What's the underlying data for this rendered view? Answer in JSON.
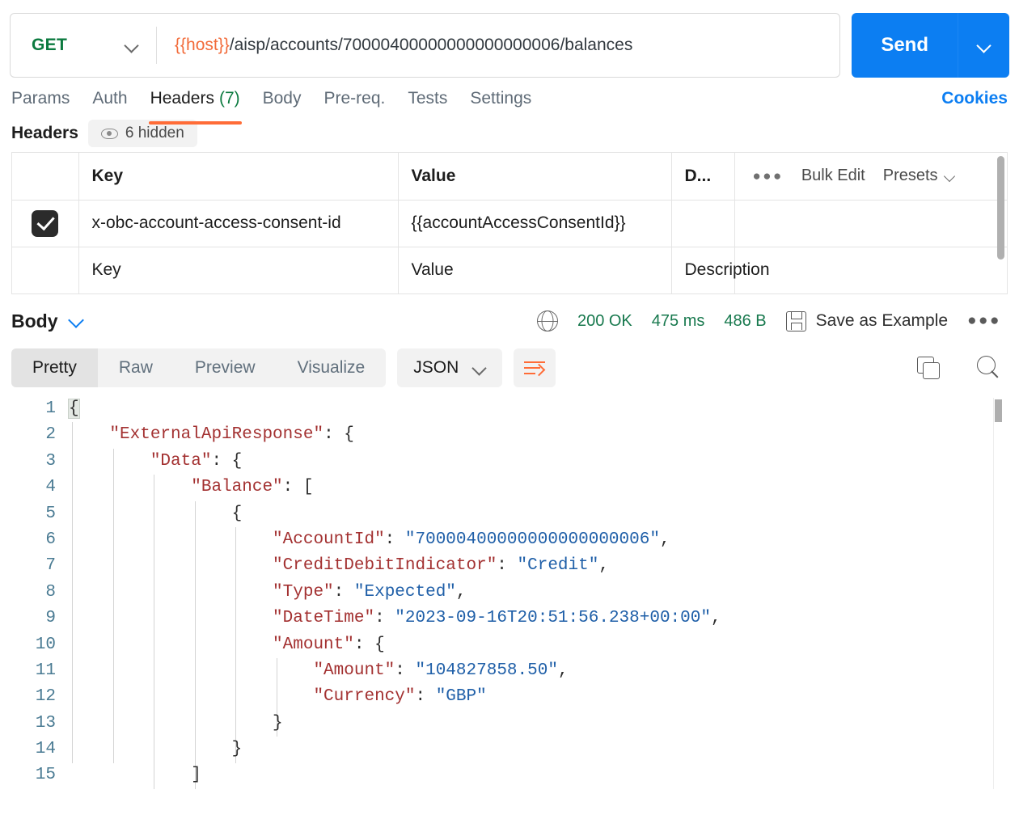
{
  "request": {
    "method": "GET",
    "method_caret_icon": "chevron-down-icon",
    "url_variable": "{{host}}",
    "url_path": "/aisp/accounts/70000400000000000000006/balances",
    "send_label": "Send",
    "send_caret_icon": "chevron-down-icon"
  },
  "request_tabs": [
    {
      "label": "Params",
      "count": "",
      "active": false
    },
    {
      "label": "Auth",
      "count": "",
      "active": false
    },
    {
      "label": "Headers",
      "count": "(7)",
      "active": true
    },
    {
      "label": "Body",
      "count": "",
      "active": false
    },
    {
      "label": "Pre-req.",
      "count": "",
      "active": false
    },
    {
      "label": "Tests",
      "count": "",
      "active": false
    },
    {
      "label": "Settings",
      "count": "",
      "active": false
    }
  ],
  "cookies_label": "Cookies",
  "headers_section": {
    "title": "Headers",
    "hidden_pill_label": "6 hidden",
    "eye_icon": "eye-icon",
    "columns": {
      "check": "",
      "key": "Key",
      "value": "Value",
      "description": "D..."
    },
    "toolbar": {
      "more_icon": "more-horizontal-icon",
      "bulk_edit": "Bulk Edit",
      "presets": "Presets",
      "presets_caret_icon": "chevron-down-icon"
    },
    "rows": [
      {
        "checked": true,
        "key": "x-obc-account-access-consent-id",
        "value": "{{accountAccessConsentId}}",
        "description": ""
      }
    ],
    "placeholder_row": {
      "key": "Key",
      "value": "Value",
      "description": "Description"
    }
  },
  "response": {
    "body_label": "Body",
    "body_caret_icon": "chevron-down-icon",
    "globe_icon": "globe-icon",
    "status": "200 OK",
    "time": "475 ms",
    "size": "486 B",
    "save_icon": "floppy-disk-icon",
    "save_as_example": "Save as Example",
    "more_icon": "more-horizontal-icon",
    "view_tabs": [
      {
        "label": "Pretty",
        "active": true
      },
      {
        "label": "Raw",
        "active": false
      },
      {
        "label": "Preview",
        "active": false
      },
      {
        "label": "Visualize",
        "active": false
      }
    ],
    "language": "JSON",
    "language_caret_icon": "chevron-down-icon",
    "wrap_icon": "word-wrap-icon",
    "copy_icon": "copy-icon",
    "search_icon": "search-icon",
    "code_lines": [
      {
        "n": "1",
        "indent": 0,
        "tokens": [
          {
            "t": "{",
            "c": "p",
            "hl": true
          }
        ]
      },
      {
        "n": "2",
        "indent": 1,
        "tokens": [
          {
            "t": "\"ExternalApiResponse\"",
            "c": "k"
          },
          {
            "t": ": {",
            "c": "p"
          }
        ]
      },
      {
        "n": "3",
        "indent": 2,
        "tokens": [
          {
            "t": "\"Data\"",
            "c": "k"
          },
          {
            "t": ": {",
            "c": "p"
          }
        ]
      },
      {
        "n": "4",
        "indent": 3,
        "tokens": [
          {
            "t": "\"Balance\"",
            "c": "k"
          },
          {
            "t": ": [",
            "c": "p"
          }
        ]
      },
      {
        "n": "5",
        "indent": 4,
        "tokens": [
          {
            "t": "{",
            "c": "p"
          }
        ]
      },
      {
        "n": "6",
        "indent": 5,
        "tokens": [
          {
            "t": "\"AccountId\"",
            "c": "k"
          },
          {
            "t": ": ",
            "c": "p"
          },
          {
            "t": "\"70000400000000000000006\"",
            "c": "s"
          },
          {
            "t": ",",
            "c": "p"
          }
        ]
      },
      {
        "n": "7",
        "indent": 5,
        "tokens": [
          {
            "t": "\"CreditDebitIndicator\"",
            "c": "k"
          },
          {
            "t": ": ",
            "c": "p"
          },
          {
            "t": "\"Credit\"",
            "c": "s"
          },
          {
            "t": ",",
            "c": "p"
          }
        ]
      },
      {
        "n": "8",
        "indent": 5,
        "tokens": [
          {
            "t": "\"Type\"",
            "c": "k"
          },
          {
            "t": ": ",
            "c": "p"
          },
          {
            "t": "\"Expected\"",
            "c": "s"
          },
          {
            "t": ",",
            "c": "p"
          }
        ]
      },
      {
        "n": "9",
        "indent": 5,
        "tokens": [
          {
            "t": "\"DateTime\"",
            "c": "k"
          },
          {
            "t": ": ",
            "c": "p"
          },
          {
            "t": "\"2023-09-16T20:51:56.238+00:00\"",
            "c": "s"
          },
          {
            "t": ",",
            "c": "p"
          }
        ]
      },
      {
        "n": "10",
        "indent": 5,
        "tokens": [
          {
            "t": "\"Amount\"",
            "c": "k"
          },
          {
            "t": ": {",
            "c": "p"
          }
        ]
      },
      {
        "n": "11",
        "indent": 6,
        "tokens": [
          {
            "t": "\"Amount\"",
            "c": "k"
          },
          {
            "t": ": ",
            "c": "p"
          },
          {
            "t": "\"104827858.50\"",
            "c": "s"
          },
          {
            "t": ",",
            "c": "p"
          }
        ]
      },
      {
        "n": "12",
        "indent": 6,
        "tokens": [
          {
            "t": "\"Currency\"",
            "c": "k"
          },
          {
            "t": ": ",
            "c": "p"
          },
          {
            "t": "\"GBP\"",
            "c": "s"
          }
        ]
      },
      {
        "n": "13",
        "indent": 5,
        "tokens": [
          {
            "t": "}",
            "c": "p"
          }
        ]
      },
      {
        "n": "14",
        "indent": 4,
        "tokens": [
          {
            "t": "}",
            "c": "p"
          }
        ]
      },
      {
        "n": "15",
        "indent": 3,
        "tokens": [
          {
            "t": "]",
            "c": "p"
          }
        ]
      }
    ]
  },
  "colors": {
    "accent": "#ff6c37",
    "send_blue": "#0c7ef2",
    "method_green": "#0b7a3f",
    "status_green": "#18794e",
    "variable_orange": "#f26b3a",
    "json_key": "#a33131",
    "json_string": "#1f5fa8"
  }
}
